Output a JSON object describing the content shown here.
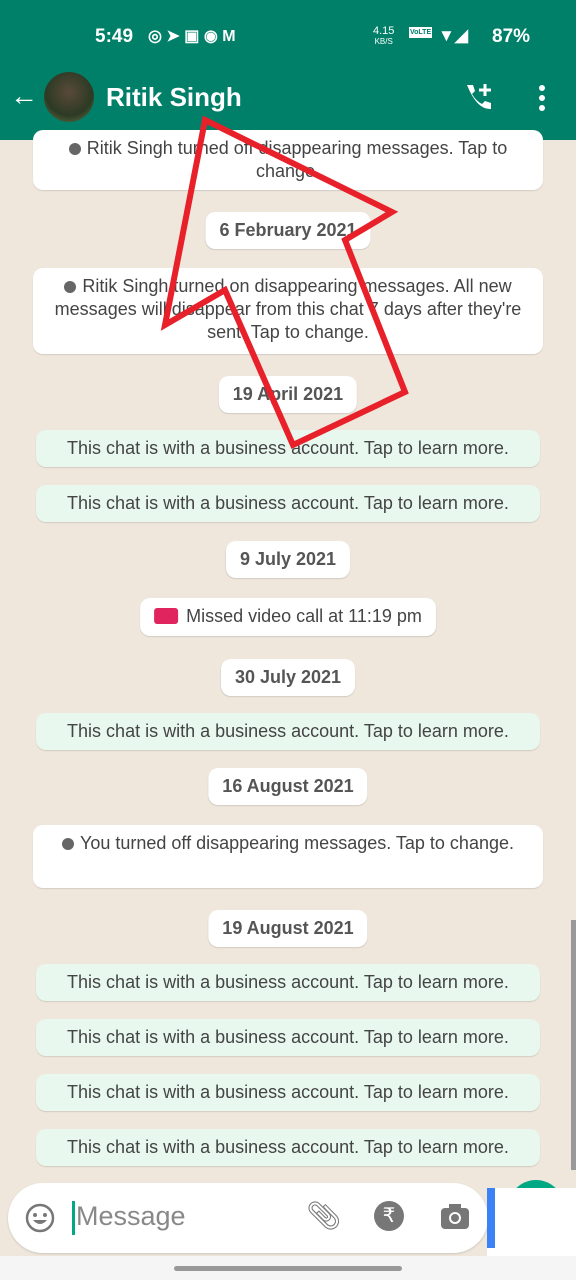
{
  "status_bar": {
    "time": "5:49",
    "net_speed": "4.15",
    "net_unit": "KB/S",
    "volte": "VoLTE",
    "battery": "87%"
  },
  "header": {
    "contact_name": "Ritik Singh"
  },
  "messages": [
    {
      "type": "system",
      "text": "Ritik Singh turned off disappearing messages. Tap to change."
    },
    {
      "type": "date",
      "text": "6 February 2021"
    },
    {
      "type": "system",
      "text": "Ritik Singh turned on disappearing messages. All new messages will disappear from this chat 7 days after they're sent. Tap to change."
    },
    {
      "type": "date",
      "text": "19 April 2021"
    },
    {
      "type": "business",
      "text": "This chat is with a business account. Tap to learn more."
    },
    {
      "type": "business",
      "text": "This chat is with a business account. Tap to learn more."
    },
    {
      "type": "date",
      "text": "9 July 2021"
    },
    {
      "type": "missed_call",
      "text": "Missed video call at 11:19 pm"
    },
    {
      "type": "date",
      "text": "30 July 2021"
    },
    {
      "type": "business",
      "text": "This chat is with a business account. Tap to learn more."
    },
    {
      "type": "date",
      "text": "16 August 2021"
    },
    {
      "type": "system",
      "text": "You turned off disappearing messages. Tap to change."
    },
    {
      "type": "date",
      "text": "19 August 2021"
    },
    {
      "type": "business",
      "text": "This chat is with a business account. Tap to learn more."
    },
    {
      "type": "business",
      "text": "This chat is with a business account. Tap to learn more."
    },
    {
      "type": "business",
      "text": "This chat is with a business account. Tap to learn more."
    },
    {
      "type": "business",
      "text": "This chat is with a business account. Tap to learn more."
    }
  ],
  "composer": {
    "placeholder": "Message"
  },
  "colors": {
    "header": "#008069",
    "annotation_arrow": "#e8202a",
    "missed_call": "#e0245e"
  }
}
